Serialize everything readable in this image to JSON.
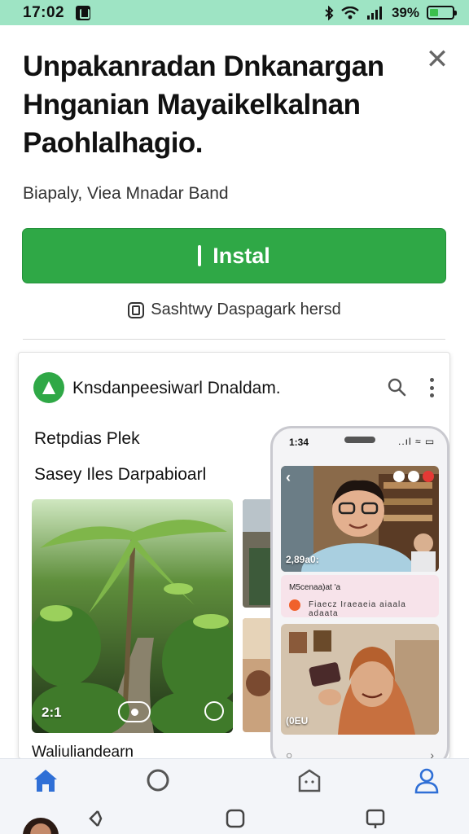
{
  "status_bar": {
    "time": "17:02",
    "battery_text": "39%",
    "battery_level": 0.39,
    "icons": [
      "app-notification-icon",
      "bluetooth-icon",
      "wifi-icon",
      "signal-icon",
      "battery-icon"
    ]
  },
  "sheet": {
    "title": "Unpakanradan Dnkanargan Hnganian Mayaikelkalnan Paohlalhagio.",
    "publisher": "Biapaly, Viea Mnadar Band",
    "install_label": "Instal",
    "safety_text": "Sashtwy Daspagark hersd",
    "close_icon": "close-icon",
    "accent": "#2fa846",
    "status_bar_color": "#9ee4c4"
  },
  "preview": {
    "app_name": "Knsdanpeesiwarl Dnaldam.",
    "section_title": "Retpdias Plek",
    "section_subtitle": "Sasey Iles Darpabioarl",
    "video_duration": "2:1",
    "caption": "Waliuliandearn",
    "phone": {
      "time": "1:34",
      "status_icons": "..ıl ≈ ▭",
      "photo1_overlay": "2,89a0:",
      "chat_line": "M5cenaa)at 'a",
      "chat_meta": "Fiaecz  Iraeaeia  aiaala  adaata",
      "photo2_overlay": "(0EU"
    }
  },
  "bottom_nav": {
    "items": [
      "home-icon",
      "circle-icon",
      "store-icon",
      "profile-icon"
    ],
    "active": "home-icon",
    "system_buttons": [
      "back-icon",
      "home-square-icon",
      "recents-icon"
    ]
  }
}
